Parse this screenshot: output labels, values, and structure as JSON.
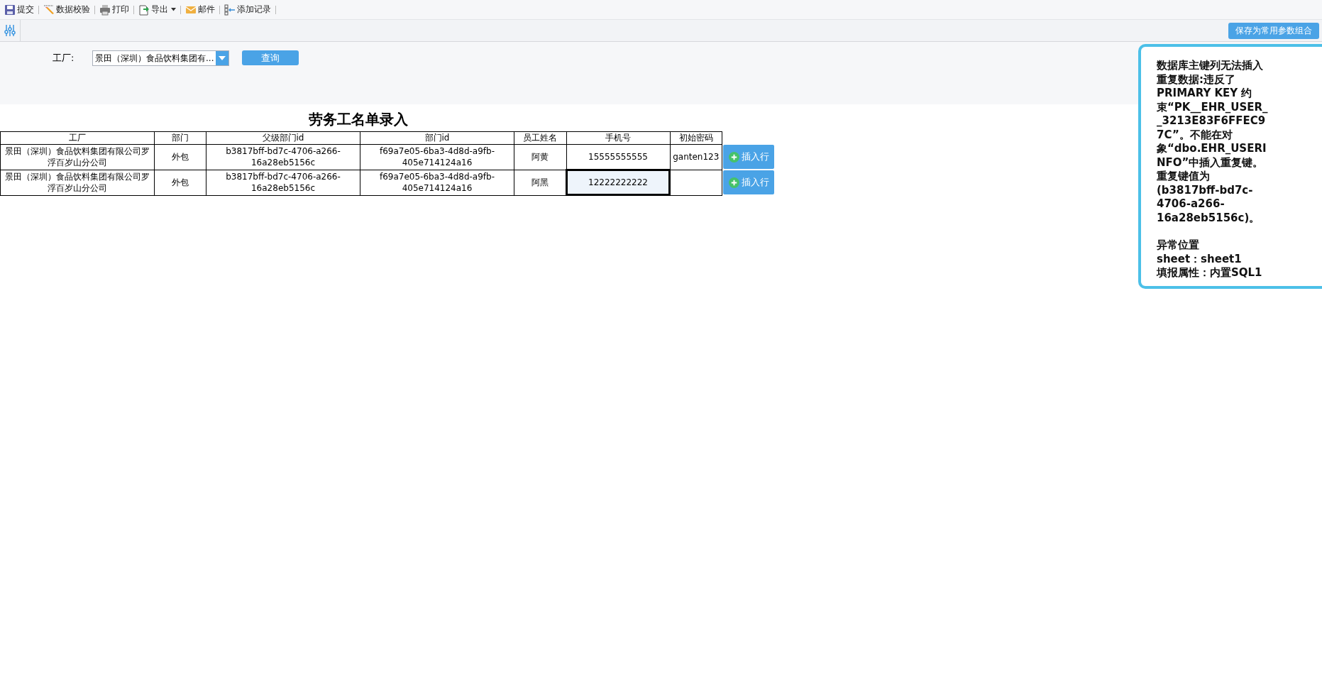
{
  "toolbar": [
    {
      "kind": "save",
      "label": "提交",
      "has_menu": false
    },
    {
      "kind": "validate",
      "label": "数据校验",
      "has_menu": false
    },
    {
      "kind": "print",
      "label": "打印",
      "has_menu": false
    },
    {
      "kind": "export",
      "label": "导出",
      "has_menu": true
    },
    {
      "kind": "mail",
      "label": "邮件",
      "has_menu": false
    },
    {
      "kind": "add",
      "label": "添加记录",
      "has_menu": false
    }
  ],
  "param_bar": {
    "save_button": "保存为常用参数组合"
  },
  "filter": {
    "label": "工厂:",
    "value": "景田（深圳）食品饮料集团有...",
    "query_button": "查询"
  },
  "report": {
    "title": "劳务工名单录入",
    "columns": [
      "工厂",
      "部门",
      "父级部门id",
      "部门id",
      "员工姓名",
      "手机号",
      "初始密码"
    ],
    "rows": [
      {
        "cells": [
          {
            "text": "景田（深圳）食品饮料集团有限公司罗浮百岁山分公司",
            "selected": false
          },
          {
            "text": "外包",
            "selected": false
          },
          {
            "text": "b3817bff-bd7c-4706-a266-16a28eb5156c",
            "selected": false
          },
          {
            "text": "f69a7e05-6ba3-4d8d-a9fb-405e714124a16",
            "selected": false
          },
          {
            "text": "阿黄",
            "selected": false
          },
          {
            "text": "15555555555",
            "selected": false
          },
          {
            "text": "ganten123",
            "selected": false
          }
        ],
        "insert_button": "插入行"
      },
      {
        "cells": [
          {
            "text": "景田（深圳）食品饮料集团有限公司罗浮百岁山分公司",
            "selected": false
          },
          {
            "text": "外包",
            "selected": false
          },
          {
            "text": "b3817bff-bd7c-4706-a266-16a28eb5156c",
            "selected": false
          },
          {
            "text": "f69a7e05-6ba3-4d8d-a9fb-405e714124a16",
            "selected": false
          },
          {
            "text": "阿黑",
            "selected": false
          },
          {
            "text": "12222222222",
            "selected": true
          },
          {
            "text": "",
            "selected": false
          }
        ],
        "insert_button": "插入行"
      }
    ]
  },
  "error_popup": {
    "message": "数据库主键列无法插入重复数据:违反了 PRIMARY KEY 约束“PK__EHR_USER__3213E83F6FFEC97C”。不能在对象“dbo.EHR_USERINFO”中插入重复键。重复键值为 (b3817bff-bd7c-4706-a266-16a28eb5156c)。",
    "location_lines": [
      "异常位置",
      "sheet：sheet1",
      "填报属性：内置SQL1"
    ]
  }
}
